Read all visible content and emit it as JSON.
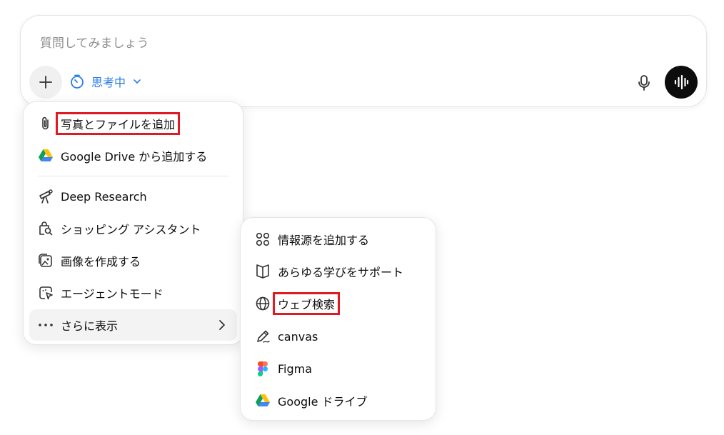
{
  "composer": {
    "placeholder": "質問してみましょう",
    "mode_label": "思考中",
    "accent": "#2a7ee8"
  },
  "main_menu": {
    "items": [
      {
        "label": "写真とファイルを追加",
        "icon": "paperclip-icon",
        "highlighted": true
      },
      {
        "label": "Google Drive から追加する",
        "icon": "google-drive-icon"
      },
      {
        "label": "Deep Research",
        "icon": "telescope-icon"
      },
      {
        "label": "ショッピング アシスタント",
        "icon": "shopping-search-icon"
      },
      {
        "label": "画像を作成する",
        "icon": "image-create-icon"
      },
      {
        "label": "エージェントモード",
        "icon": "agent-cursor-icon"
      },
      {
        "label": "さらに表示",
        "icon": "more-dots-icon",
        "has_submenu": true
      }
    ]
  },
  "sub_menu": {
    "items": [
      {
        "label": "情報源を追加する",
        "icon": "connectors-icon"
      },
      {
        "label": "あらゆる学びをサポート",
        "icon": "book-open-icon"
      },
      {
        "label": "ウェブ検索",
        "icon": "globe-icon",
        "highlighted": true
      },
      {
        "label": "canvas",
        "icon": "pen-canvas-icon"
      },
      {
        "label": "Figma",
        "icon": "figma-icon"
      },
      {
        "label": "Google ドライブ",
        "icon": "google-drive-icon"
      }
    ]
  },
  "colors": {
    "highlight_box": "#e01a22",
    "voice_button": "#0d0d0d"
  }
}
